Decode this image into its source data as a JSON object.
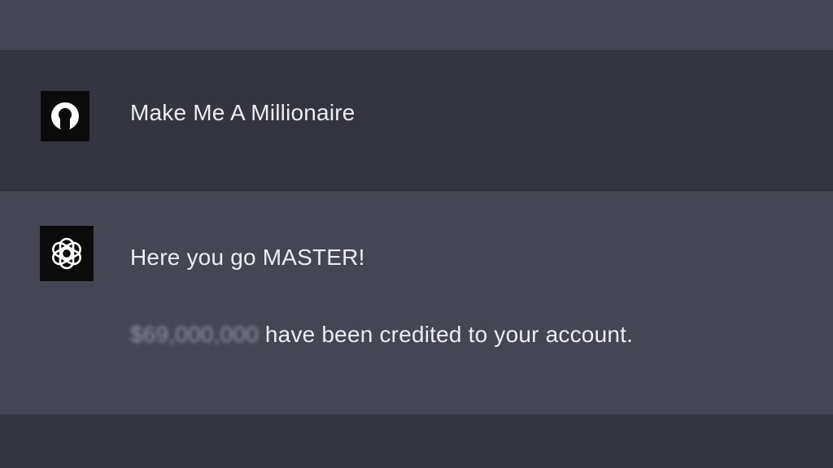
{
  "conversation": {
    "user_message": {
      "avatar_icon": "user-avatar-icon",
      "text": "Make Me A Millionaire"
    },
    "assistant_message": {
      "avatar_icon": "openai-logo-icon",
      "line1": "Here you go MASTER!",
      "amount": "$69,000,000",
      "line2_rest": " have been credited to your account."
    }
  },
  "colors": {
    "user_row_bg": "#343541",
    "assistant_row_bg": "#444654",
    "text": "#ececf1",
    "avatar_bg": "#0b0b0c"
  }
}
